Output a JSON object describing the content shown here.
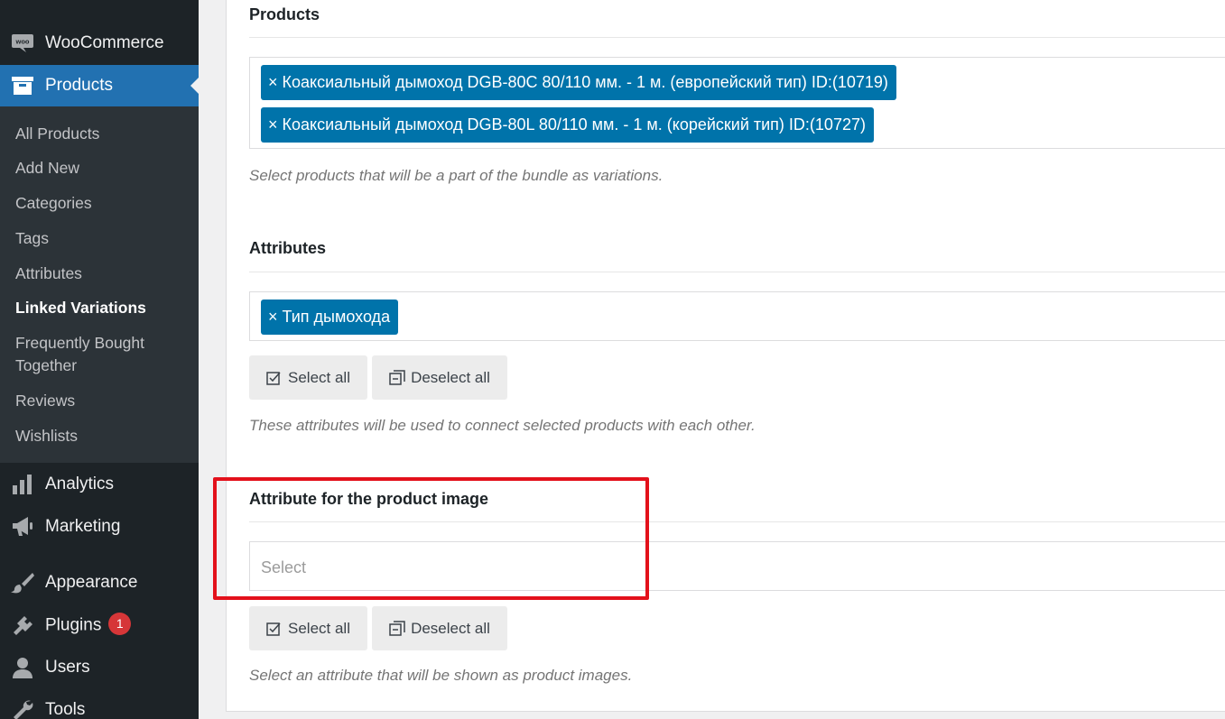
{
  "sidebar": {
    "top_items": [
      {
        "label": "WooCommerce",
        "icon": "woo-icon"
      },
      {
        "label": "Products",
        "icon": "archive-icon"
      }
    ],
    "submenu": [
      {
        "label": "All Products"
      },
      {
        "label": "Add New"
      },
      {
        "label": "Categories"
      },
      {
        "label": "Tags"
      },
      {
        "label": "Attributes"
      },
      {
        "label": "Linked Variations",
        "current": true
      },
      {
        "label": "Frequently Bought"
      },
      {
        "label": "Together"
      },
      {
        "label": "Reviews"
      },
      {
        "label": "Wishlists"
      }
    ],
    "bottom_items": [
      {
        "label": "Analytics",
        "icon": "bar-chart-icon"
      },
      {
        "label": "Marketing",
        "icon": "megaphone-icon"
      },
      {
        "label": "Appearance",
        "icon": "paintbrush-icon"
      },
      {
        "label": "Plugins",
        "icon": "plug-icon",
        "badge": "1"
      },
      {
        "label": "Users",
        "icon": "user-icon"
      },
      {
        "label": "Tools",
        "icon": "wrench-icon"
      }
    ],
    "accent_color": "#2271b1",
    "bg_color": "#1d2327"
  },
  "main": {
    "products": {
      "title": "Products",
      "selected": [
        "Коаксиальный дымоход DGB-80C 80/110 мм. - 1 м. (европейский тип) ID:(10719)",
        "Коаксиальный дымоход DGB-80L 80/110 мм. - 1 м. (корейский тип) ID:(10727)"
      ],
      "remove_glyph": "×",
      "description": "Select products that will be a part of the bundle as variations."
    },
    "attributes": {
      "title": "Attributes",
      "selected": [
        "Тип дымохода"
      ],
      "select_all": "Select all",
      "deselect_all": "Deselect all",
      "description": "These attributes will be used to connect selected products with each other."
    },
    "image_attribute": {
      "title": "Attribute for the product image",
      "placeholder": "Select",
      "select_all": "Select all",
      "deselect_all": "Deselect all",
      "description": "Select an attribute that will be shown as product images."
    },
    "chip_color": "#0073aa",
    "highlight_color": "#e3111b"
  }
}
